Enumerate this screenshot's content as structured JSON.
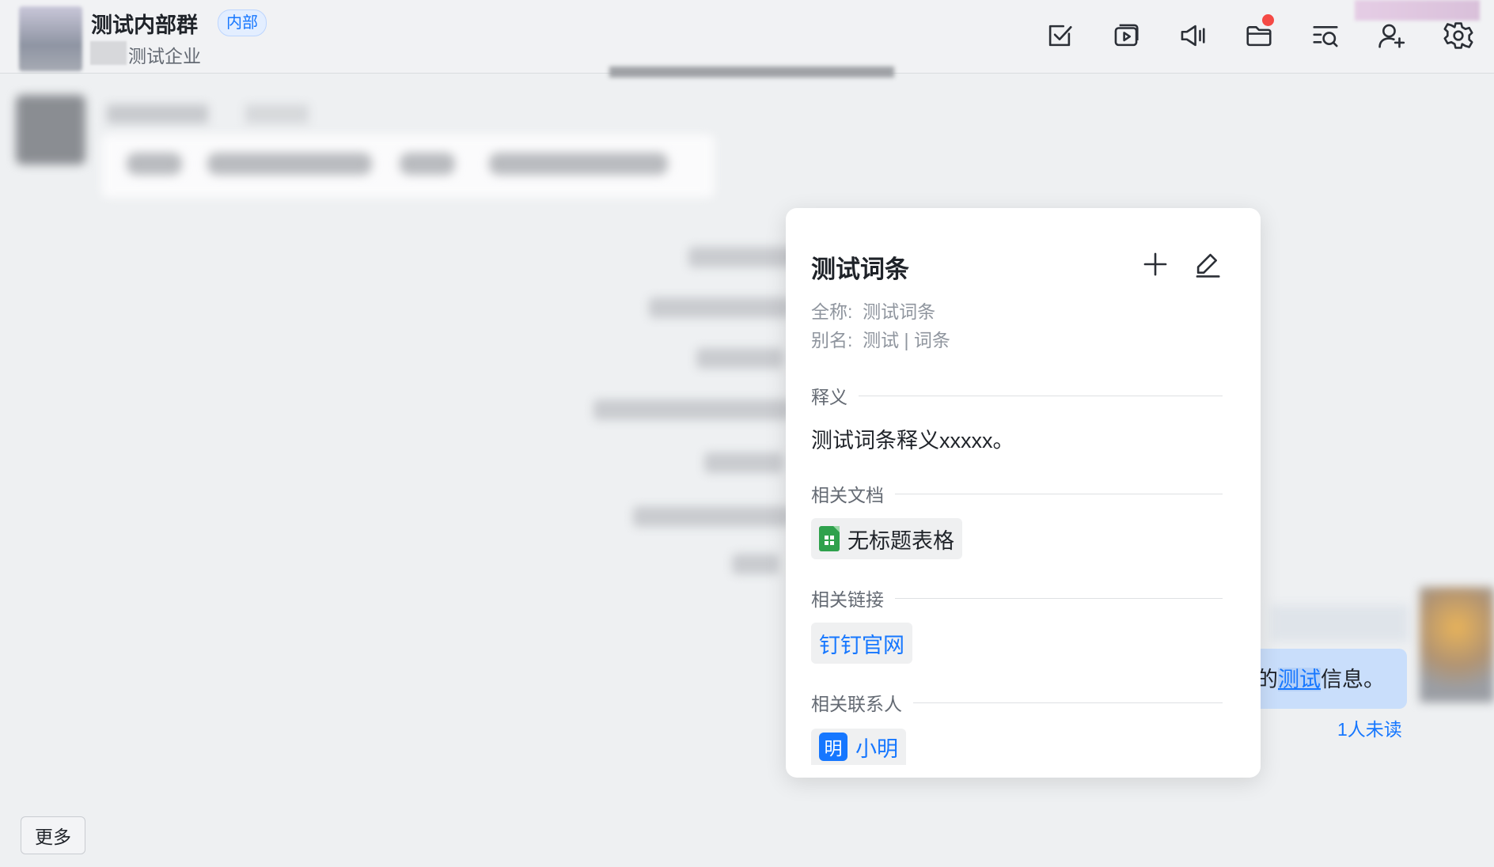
{
  "header": {
    "title": "测试内部群",
    "badge": "内部",
    "subtitle": "测试企业"
  },
  "toolbar": {
    "icons": [
      "task-check-icon",
      "meeting-icon",
      "announcement-icon",
      "folder-icon",
      "search-history-icon",
      "add-member-icon",
      "settings-icon"
    ],
    "folder_has_notification": true
  },
  "card": {
    "title": "测试词条",
    "full_name_label": "全称:",
    "full_name_value": "测试词条",
    "alias_label": "别名:",
    "alias_value": "测试 | 词条",
    "definition_label": "释义",
    "definition": "测试词条释义xxxxx。",
    "docs_label": "相关文档",
    "doc_name": "无标题表格",
    "links_label": "相关链接",
    "link_name": "钉钉官网",
    "contacts_label": "相关联系人",
    "contact_avatar": "明",
    "contact_name": "小明"
  },
  "message": {
    "prefix": "的",
    "highlight": "测试",
    "suffix": "信息。",
    "unread": "1人未读"
  },
  "more_button": "更多",
  "colors": {
    "accent": "#1677ff",
    "notification": "#f54a45",
    "sheet_green": "#2fa14c"
  }
}
